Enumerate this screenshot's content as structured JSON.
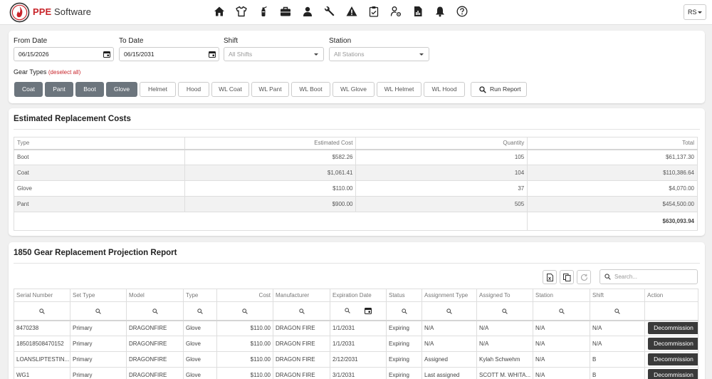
{
  "header": {
    "brand_prefix": "PPE",
    "brand_suffix": " Software",
    "nav_icons": [
      "home-icon",
      "shirt-icon",
      "extinguisher-icon",
      "briefcase-icon",
      "user-icon",
      "wrench-icon",
      "warning-icon",
      "clipboard-icon",
      "user-settings-icon",
      "report-icon",
      "bell-icon",
      "help-icon"
    ],
    "user_initials": "RS",
    "brand_color": "#c8242a"
  },
  "filters": {
    "from_label": "From Date",
    "from_value": "06/15/2026",
    "to_label": "To Date",
    "to_value": "06/15/2031",
    "shift_label": "Shift",
    "shift_placeholder": "All Shifts",
    "station_label": "Station",
    "station_placeholder": "All Stations",
    "gear_types_label": "Gear Types",
    "deselect_label": "(deselect all)",
    "gear_buttons": [
      {
        "label": "Coat",
        "selected": true
      },
      {
        "label": "Pant",
        "selected": true
      },
      {
        "label": "Boot",
        "selected": true
      },
      {
        "label": "Glove",
        "selected": true
      },
      {
        "label": "Helmet",
        "selected": false
      },
      {
        "label": "Hood",
        "selected": false
      },
      {
        "label": "WL Coat",
        "selected": false
      },
      {
        "label": "WL Pant",
        "selected": false
      },
      {
        "label": "WL Boot",
        "selected": false
      },
      {
        "label": "WL Glove",
        "selected": false
      },
      {
        "label": "WL Helmet",
        "selected": false
      },
      {
        "label": "WL Hood",
        "selected": false
      }
    ],
    "run_report_label": "Run Report"
  },
  "costs": {
    "title": "Estimated Replacement Costs",
    "headers": [
      "Type",
      "Estimated Cost",
      "Quantity",
      "Total"
    ],
    "rows": [
      [
        "Boot",
        "$582.26",
        "105",
        "$61,137.30"
      ],
      [
        "Coat",
        "$1,061.41",
        "104",
        "$110,386.64"
      ],
      [
        "Glove",
        "$110.00",
        "37",
        "$4,070.00"
      ],
      [
        "Pant",
        "$900.00",
        "505",
        "$454,500.00"
      ]
    ],
    "grand_total": "$630,093.94"
  },
  "projection": {
    "title": "1850 Gear Replacement Projection Report",
    "search_placeholder": "Search...",
    "headers": [
      "Serial Number",
      "Set Type",
      "Model",
      "Type",
      "Cost",
      "Manufacturer",
      "Expiration Date",
      "Status",
      "Assignment Type",
      "Assigned To",
      "Station",
      "Shift",
      "Action"
    ],
    "action_label": "Decommission",
    "rows": [
      [
        "8470238",
        "Primary",
        "DRAGONFIRE",
        "Glove",
        "$110.00",
        "DRAGON FIRE",
        "1/1/2031",
        "Expiring",
        "N/A",
        "N/A",
        "N/A",
        "N/A"
      ],
      [
        "185018508470152",
        "Primary",
        "DRAGONFIRE",
        "Glove",
        "$110.00",
        "DRAGON FIRE",
        "1/1/2031",
        "Expiring",
        "N/A",
        "N/A",
        "N/A",
        "N/A"
      ],
      [
        "LOANSLIPTESTIN...",
        "Primary",
        "DRAGONFIRE",
        "Glove",
        "$110.00",
        "DRAGON FIRE",
        "2/12/2031",
        "Expiring",
        "Assigned",
        "Kylah Schwehm",
        "N/A",
        "B"
      ],
      [
        "WG1",
        "Primary",
        "DRAGONFIRE",
        "Glove",
        "$110.00",
        "DRAGON FIRE",
        "3/1/2031",
        "Expiring",
        "Last assigned",
        "SCOTT M. WHITA...",
        "N/A",
        "B"
      ]
    ]
  }
}
